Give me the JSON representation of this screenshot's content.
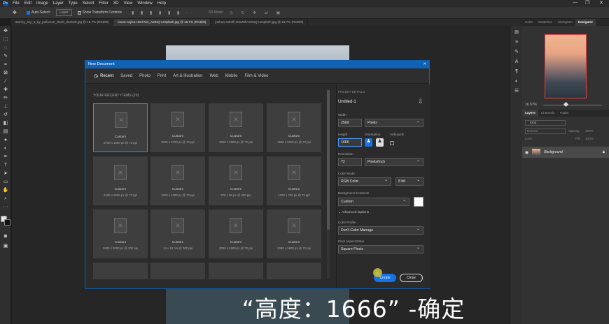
{
  "menubar": {
    "logo": "Ps",
    "items": [
      "File",
      "Edit",
      "Image",
      "Layer",
      "Type",
      "Select",
      "Filter",
      "3D",
      "View",
      "Window",
      "Help"
    ],
    "win_minimize": "—",
    "win_restore": "❐",
    "win_close": "✕"
  },
  "optbar": {
    "auto_select": "Auto-Select:",
    "layer": "Layer",
    "show_transform": "Show Transform Controls",
    "mode_3d": "3D Mode:"
  },
  "tabs": [
    "stormy_sky_3_by_pellucian_stock_d22iur8.jpg @ 16.7% (RGB/8)",
    "ieana-cajina-HDd-NO_AMNQ-unsplash.jpg @ 16.7% (RGB/8)",
    "joshua-sukoff-1NxWthAeOuQ-unsplash.jpg @ 16.7% (RGB/8)"
  ],
  "right_panel": {
    "top_tabs": [
      "Color",
      "Swatches",
      "Histogram",
      "Navigator"
    ],
    "zoom": "16.67%",
    "layer_tabs": [
      "Layers",
      "Channels",
      "Paths"
    ],
    "kind_filter": "Kind",
    "blend_mode": "Normal",
    "opacity_label": "Opacity:",
    "opacity": "100%",
    "lock_label": "Lock:",
    "fill_label": "Fill:",
    "fill": "100%",
    "layer_name": "Background"
  },
  "dialog": {
    "title": "New Document",
    "close_icon": "✕",
    "tabs": [
      "Recent",
      "Saved",
      "Photo",
      "Print",
      "Art & Illustration",
      "Web",
      "Mobile",
      "Film & Video"
    ],
    "recent_header": "YOUR RECENT ITEMS  (20)",
    "cards": [
      {
        "name": "Custom",
        "size": "2700 x 1000 px @ 72 ppi"
      },
      {
        "name": "Custom",
        "size": "3000 x 2700 px @ 72 ppi"
      },
      {
        "name": "Custom",
        "size": "3000 x 2600 px @ 72 ppi"
      },
      {
        "name": "Custom",
        "size": "1900 x 2600 px @ 72 ppi"
      },
      {
        "name": "Custom",
        "size": "2400 x 2500 px @ 72 ppi"
      },
      {
        "name": "Custom",
        "size": "1500 x 1000 px @ 72 ppi"
      },
      {
        "name": "Custom",
        "size": "570 x 90 px @ 300 ppi"
      },
      {
        "name": "Custom",
        "size": "1200 x 720 px @ 72 ppi"
      },
      {
        "name": "Custom",
        "size": "2600 x 3000 px @ 300 ppi"
      },
      {
        "name": "Custom",
        "size": "14 x 10 cm @ 300 ppi"
      },
      {
        "name": "Custom",
        "size": "2000 x 2000 px @ 72 ppi"
      },
      {
        "name": "Custom",
        "size": "1080 x 1920 px @ 72 ppi"
      }
    ],
    "details": {
      "header": "PRESET DETAILS",
      "preset_name": "Untitled-1",
      "width_label": "Width",
      "width": "2500",
      "width_unit": "Pixels",
      "height_label": "Height",
      "height": "1666",
      "orientation_label": "Orientation",
      "artboards_label": "Artboards",
      "resolution_label": "Resolution",
      "resolution": "72",
      "resolution_unit": "Pixels/Inch",
      "color_mode_label": "Color Mode",
      "color_mode": "RGB Color",
      "bit_depth": "8 bit",
      "bg_contents_label": "Background Contents",
      "bg_contents": "Custom",
      "advanced": "Advanced Options",
      "color_profile_label": "Color Profile",
      "color_profile": "Don't Color Manage",
      "pixel_aspect_label": "Pixel Aspect Ratio",
      "pixel_aspect": "Square Pixels"
    },
    "create": "Create",
    "close": "Close"
  },
  "subtitle": "“高度：1666” -确定"
}
